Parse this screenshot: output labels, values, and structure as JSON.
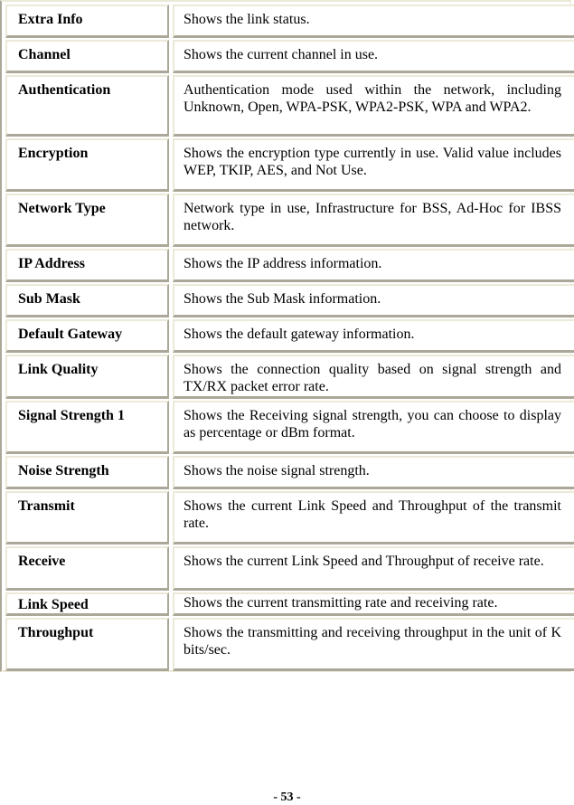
{
  "table": {
    "rows": [
      {
        "label": "Extra Info",
        "description": "Shows the link status."
      },
      {
        "label": "Channel",
        "description": "Shows the current channel in use."
      },
      {
        "label": "Authentication",
        "description": "Authentication mode used within the network, including Unknown, Open, WPA-PSK, WPA2-PSK, WPA and WPA2."
      },
      {
        "label": "Encryption",
        "description": "Shows the encryption type currently in use. Valid value includes WEP, TKIP, AES, and Not Use."
      },
      {
        "label": "Network Type",
        "description": "Network type in use, Infrastructure for BSS, Ad-Hoc for IBSS network."
      },
      {
        "label": "IP Address",
        "description": "Shows the IP address information."
      },
      {
        "label": "Sub Mask",
        "description": "Shows the Sub Mask information."
      },
      {
        "label": "Default Gateway",
        "description": "Shows the default gateway information."
      },
      {
        "label": "Link Quality",
        "description": "Shows the connection quality based on signal strength and TX/RX packet error rate."
      },
      {
        "label": "Signal Strength 1",
        "description": "Shows the Receiving signal strength, you can choose to display as percentage or dBm format."
      },
      {
        "label": "Noise Strength",
        "description": "Shows the noise signal strength."
      },
      {
        "label": "Transmit",
        "description": "Shows the current Link Speed and Throughput of the transmit rate."
      },
      {
        "label": "Receive",
        "description": "Shows the current Link Speed and Throughput of receive rate."
      },
      {
        "label": "Link Speed",
        "description": "Shows the current transmitting rate and receiving rate."
      },
      {
        "label": "Throughput",
        "description": "Shows the transmitting and receiving throughput in the unit of K bits/sec."
      }
    ]
  },
  "footer": {
    "page_number": "- 53 -"
  }
}
